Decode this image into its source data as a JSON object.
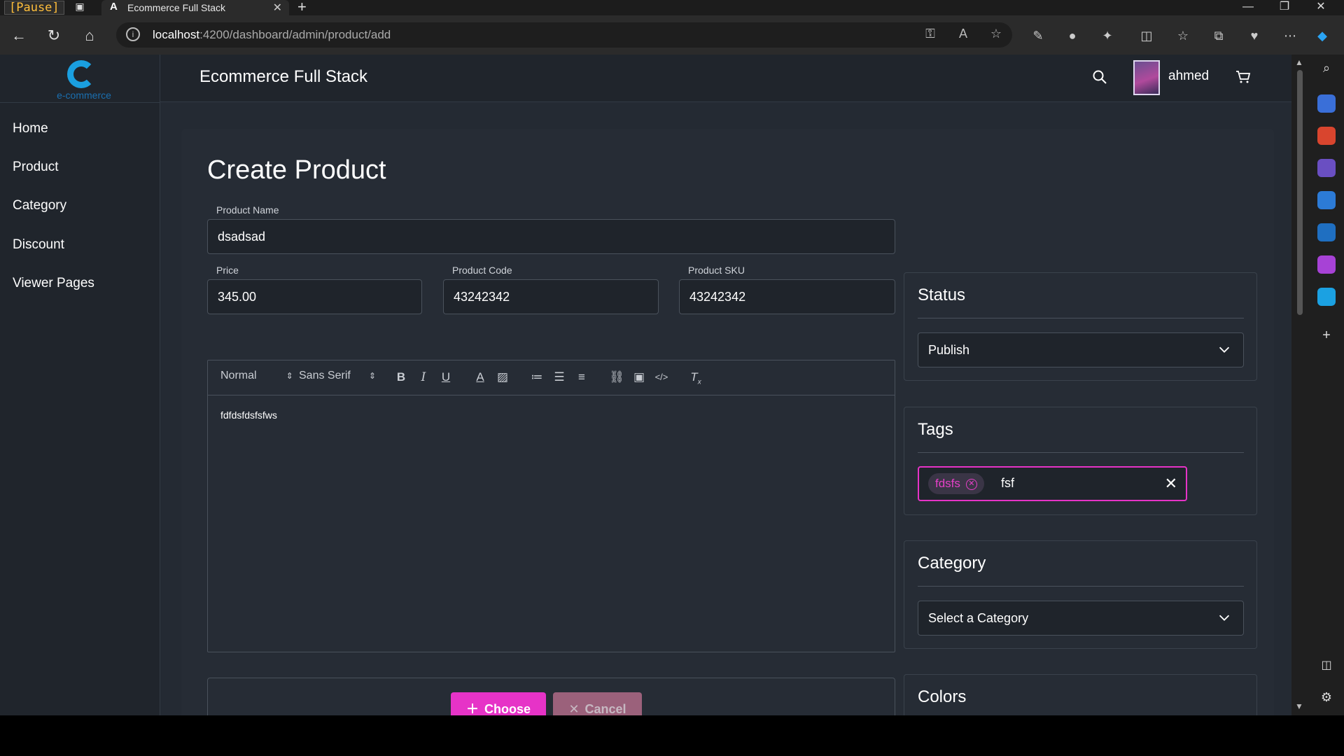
{
  "browser": {
    "recorder_badge": "[Pause]",
    "tab_title": "Ecommerce Full Stack",
    "url_host": "localhost",
    "url_path": ":4200/dashboard/admin/product/add"
  },
  "sidebar": {
    "logo_text": "e-commerce",
    "items": [
      {
        "label": "Home"
      },
      {
        "label": "Product"
      },
      {
        "label": "Category"
      },
      {
        "label": "Discount"
      },
      {
        "label": "Viewer Pages"
      }
    ]
  },
  "header": {
    "brand": "Ecommerce Full Stack",
    "user_name": "ahmed"
  },
  "form": {
    "title": "Create Product",
    "product_name_label": "Product Name",
    "product_name_value": "dsadsad",
    "price_label": "Price",
    "price_value": "345.00",
    "code_label": "Product Code",
    "code_value": "43242342",
    "sku_label": "Product SKU",
    "sku_value": "43242342",
    "editor": {
      "heading_select": "Normal",
      "font_select": "Sans Serif",
      "content": "fdfdsfdsfsfws"
    },
    "upload": {
      "choose_label": "Choose",
      "cancel_label": "Cancel"
    }
  },
  "status_panel": {
    "title": "Status",
    "selected": "Publish"
  },
  "tags_panel": {
    "title": "Tags",
    "chips": [
      "fdsfs"
    ],
    "input_value": "fsf"
  },
  "category_panel": {
    "title": "Category",
    "placeholder": "Select a Category"
  },
  "colors_panel": {
    "title": "Colors",
    "swatches": [
      "#8f97a8",
      "#8db83a",
      "#a3891f",
      "#f5cf2a",
      "#943a52",
      "#2ea9d8",
      "#2e6a94",
      "#e3557a"
    ]
  },
  "accent_color": "#e633c7"
}
